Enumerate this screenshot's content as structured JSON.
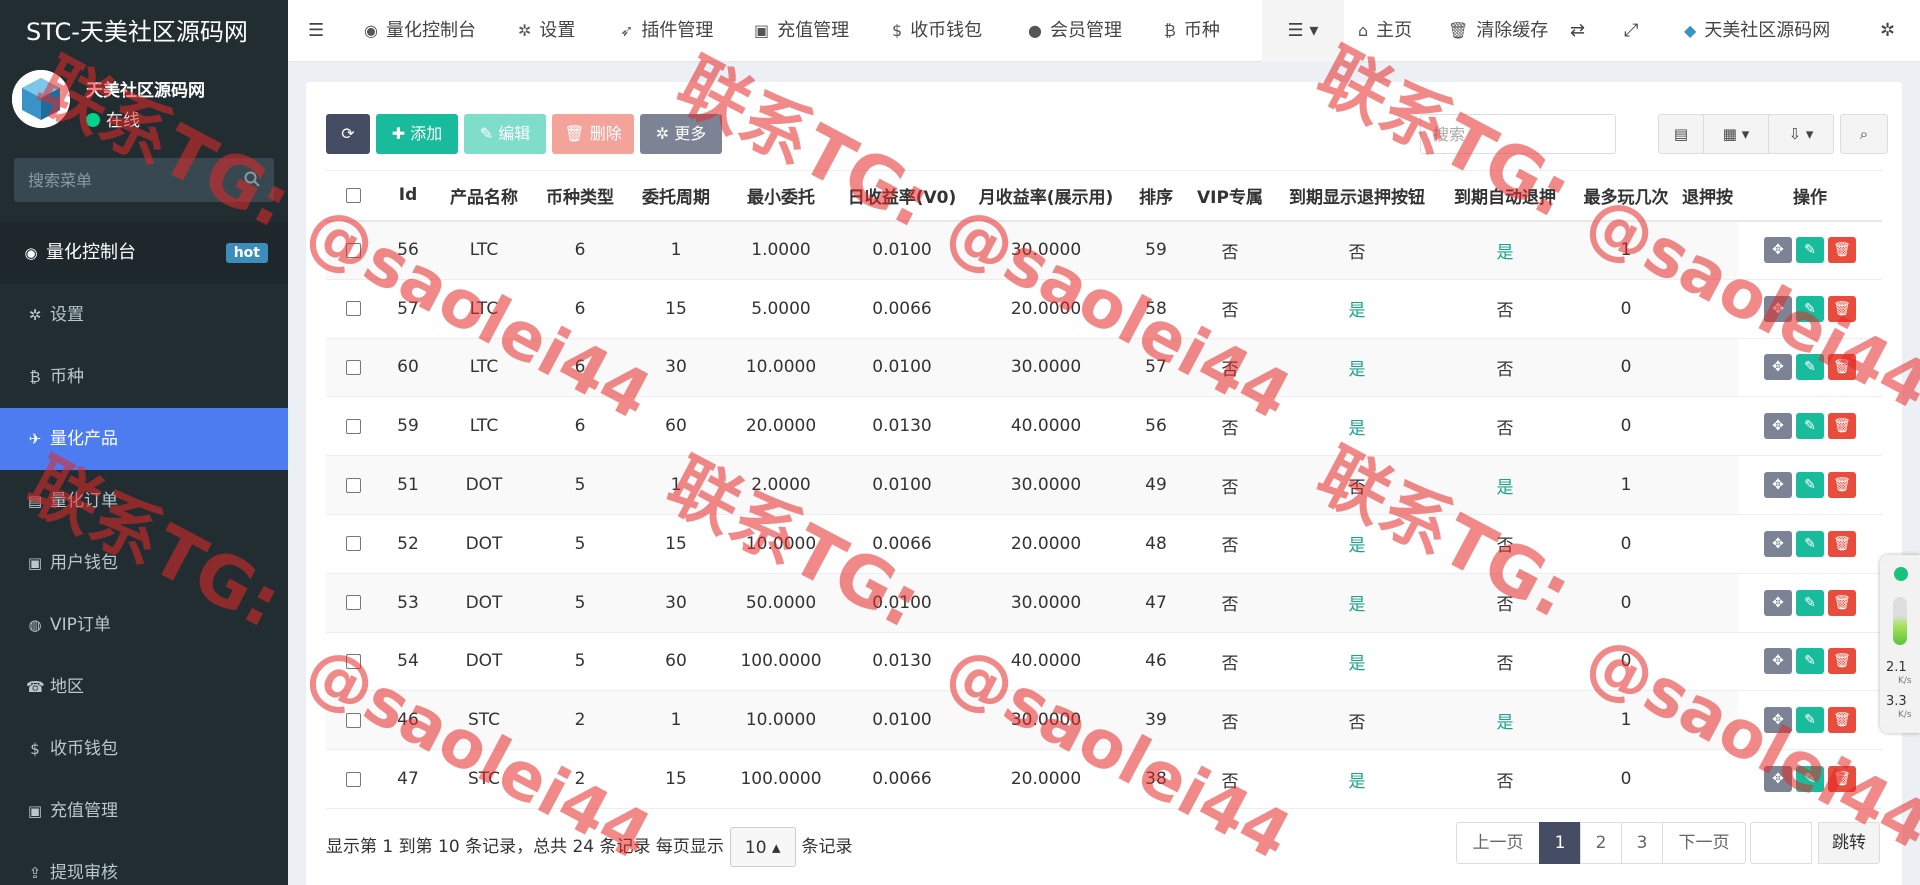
{
  "app": {
    "title": "STC-天美社区源码网"
  },
  "user": {
    "name": "天美社区源码网",
    "status": "在线"
  },
  "sidebar": {
    "search_placeholder": "搜索菜单",
    "head": {
      "label": "量化控制台",
      "badge": "hot"
    },
    "items": [
      {
        "label": "设置",
        "icon": "gear-icon"
      },
      {
        "label": "币种",
        "icon": "bitcoin-icon"
      },
      {
        "label": "量化产品",
        "icon": "plane-icon",
        "active": true
      },
      {
        "label": "量化订单",
        "icon": "book-icon"
      },
      {
        "label": "用户钱包",
        "icon": "money-icon"
      },
      {
        "label": "VIP订单",
        "icon": "chevron-circle-icon"
      },
      {
        "label": "地区",
        "icon": "phone-icon"
      },
      {
        "label": "收币钱包",
        "icon": "dollar-icon"
      },
      {
        "label": "充值管理",
        "icon": "money-icon"
      },
      {
        "label": "提现审核",
        "icon": "upload-icon"
      }
    ]
  },
  "topnav": {
    "items": [
      {
        "label": "量化控制台",
        "icon": "dashboard-icon"
      },
      {
        "label": "设置",
        "icon": "gear-icon"
      },
      {
        "label": "插件管理",
        "icon": "rocket-icon"
      },
      {
        "label": "充值管理",
        "icon": "money-icon"
      },
      {
        "label": "收币钱包",
        "icon": "dollar-icon"
      },
      {
        "label": "会员管理",
        "icon": "user-icon"
      },
      {
        "label": "币种",
        "icon": "bitcoin-icon"
      }
    ],
    "right": {
      "home": "主页",
      "clear_cache": "清除缓存",
      "site_name": "天美社区源码网"
    }
  },
  "toolbar": {
    "add": "添加",
    "edit": "编辑",
    "delete": "删除",
    "more": "更多",
    "search_placeholder": "搜索"
  },
  "table": {
    "columns": [
      "Id",
      "产品名称",
      "币种类型",
      "委托周期",
      "最小委托",
      "日收益率(V0)",
      "月收益率(展示用)",
      "排序",
      "VIP专属",
      "到期显示退押按钮",
      "到期自动退押",
      "最多玩几次",
      "退押按",
      "操作"
    ],
    "rows": [
      [
        "56",
        "LTC",
        "6",
        "1",
        "1.0000",
        "0.0100",
        "30.0000",
        "59",
        "否",
        "否",
        "是",
        "1"
      ],
      [
        "57",
        "LTC",
        "6",
        "15",
        "5.0000",
        "0.0066",
        "20.0000",
        "58",
        "否",
        "是",
        "否",
        "0"
      ],
      [
        "60",
        "LTC",
        "6",
        "30",
        "10.0000",
        "0.0100",
        "30.0000",
        "57",
        "否",
        "是",
        "否",
        "0"
      ],
      [
        "59",
        "LTC",
        "6",
        "60",
        "20.0000",
        "0.0130",
        "40.0000",
        "56",
        "否",
        "是",
        "否",
        "0"
      ],
      [
        "51",
        "DOT",
        "5",
        "1",
        "2.0000",
        "0.0100",
        "30.0000",
        "49",
        "否",
        "否",
        "是",
        "1"
      ],
      [
        "52",
        "DOT",
        "5",
        "15",
        "10.0000",
        "0.0066",
        "20.0000",
        "48",
        "否",
        "是",
        "否",
        "0"
      ],
      [
        "53",
        "DOT",
        "5",
        "30",
        "50.0000",
        "0.0100",
        "30.0000",
        "47",
        "否",
        "是",
        "否",
        "0"
      ],
      [
        "54",
        "DOT",
        "5",
        "60",
        "100.0000",
        "0.0130",
        "40.0000",
        "46",
        "否",
        "是",
        "否",
        "0"
      ],
      [
        "46",
        "STC",
        "2",
        "1",
        "10.0000",
        "0.0100",
        "30.0000",
        "39",
        "否",
        "否",
        "是",
        "1"
      ],
      [
        "47",
        "STC",
        "2",
        "15",
        "100.0000",
        "0.0066",
        "20.0000",
        "38",
        "否",
        "是",
        "否",
        "0"
      ]
    ]
  },
  "footer": {
    "summary_prefix": "显示第 1 到第 10 条记录，总共 24 条记录 每页显示",
    "page_size": "10",
    "summary_suffix": "条记录"
  },
  "pagination": {
    "prev": "上一页",
    "pages": [
      "1",
      "2",
      "3"
    ],
    "next": "下一页",
    "jump": "跳转"
  },
  "watermark": {
    "line1": "联系TG:",
    "line2": "@saolei44"
  },
  "net_widget": {
    "up": "2.1",
    "down": "3.3",
    "unit": "K/s"
  },
  "colors": {
    "sidebar": "#222d32",
    "active": "#4d7cf0",
    "primary": "#444d64",
    "success": "#18bc9c",
    "danger": "#e74c3c",
    "yes": "#18a689"
  }
}
